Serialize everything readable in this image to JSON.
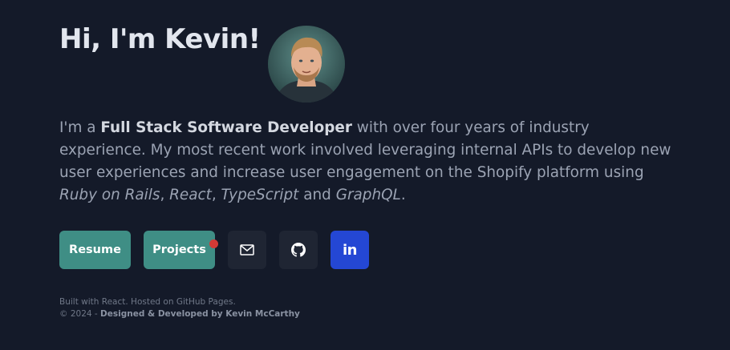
{
  "header": {
    "title": "Hi, I'm Kevin!"
  },
  "intro": {
    "prefix": "I'm a ",
    "role": "Full Stack Software Developer",
    "text_1": " with over four years of industry experience. My most recent work involved leveraging internal APIs to develop new user experiences and increase user engagement on the Shopify platform using ",
    "tech_1": "Ruby on Rails",
    "sep_1": ", ",
    "tech_2": "React",
    "sep_2": ", ",
    "tech_3": "TypeScript",
    "sep_3": " and ",
    "tech_4": "GraphQL",
    "end": "."
  },
  "buttons": {
    "resume_label": "Resume",
    "projects_label": "Projects",
    "linkedin_label": "in"
  },
  "icons": {
    "mail": "mail-icon",
    "github": "github-icon",
    "linkedin": "linkedin-icon",
    "notification": "notification-dot"
  },
  "colors": {
    "background": "#141a29",
    "accent_button": "#3f8e85",
    "icon_button": "#1f2533",
    "linkedin": "#2447d4",
    "notification": "#d23a36"
  },
  "footer": {
    "line_1": "Built with React. Hosted on GitHub Pages.",
    "copyright": "© 2024 - ",
    "credit": "Designed & Developed by Kevin McCarthy"
  }
}
